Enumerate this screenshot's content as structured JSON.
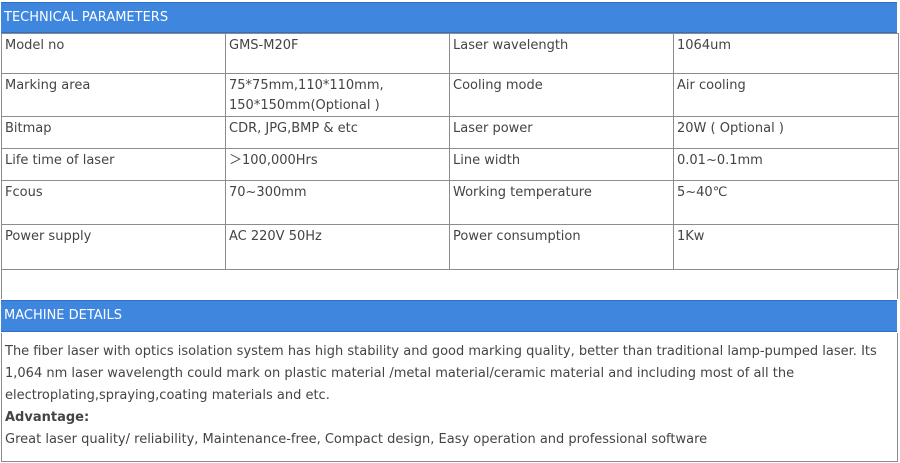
{
  "technical_parameters": {
    "heading": "TECHNICAL PARAMETERS",
    "rows": [
      [
        "Model no",
        "GMS-M20F",
        "Laser wavelength",
        "1064um"
      ],
      [
        "Marking area",
        "75*75mm,110*110mm, 150*150mm(Optional )",
        "Cooling mode",
        "Air cooling"
      ],
      [
        "Bitmap",
        "CDR, JPG,BMP & etc",
        "Laser power",
        "20W ( Optional )"
      ],
      [
        "Life time of laser",
        "＞100,000Hrs",
        "Line width",
        "0.01~0.1mm"
      ],
      [
        "Fcous",
        "70~300mm",
        "Working temperature",
        "5~40℃"
      ],
      [
        "Power supply",
        "AC 220V 50Hz",
        "Power consumption",
        "1Kw"
      ]
    ]
  },
  "machine_details": {
    "heading": "MACHINE DETAILS",
    "description": "The fiber laser with optics isolation system has high stability and good marking quality, better than traditional lamp-pumped laser. Its 1,064 nm laser wavelength could mark on plastic material /metal material/ceramic material and including most of all the electroplating,spraying,coating materials and etc.",
    "advantage_label": "Advantage:",
    "advantage_text": "Great laser quality/ reliability, Maintenance-free, Compact design, Easy operation and professional software"
  },
  "colors": {
    "header_bg": "#3f86de",
    "header_text": "#ffffff",
    "border": "#8c8c8c",
    "text": "#444444"
  }
}
